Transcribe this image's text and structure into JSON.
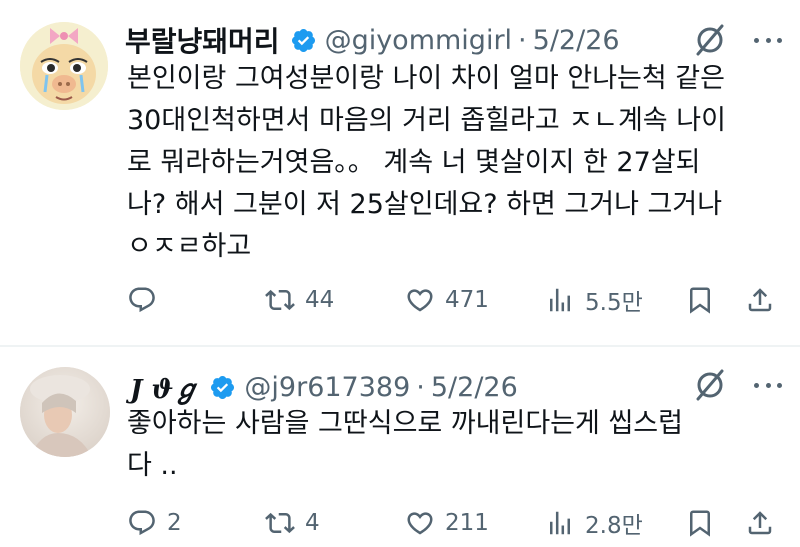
{
  "tweets": [
    {
      "display_name": "부랄냥돼머리",
      "handle": "@giyommigirl",
      "separator": "·",
      "date": "5/2/26",
      "body_lines": [
        "본인이랑 그여성분이랑 나이 차이 얼마 안나는척 같은",
        "30대인척하면서 마음의 거리 좁힐라고 ㅈㄴ계속 나이",
        "로 뭐라하는거엿음。。 계속 너 몇살이지 한 27살되",
        "나? 해서 그분이 저 25살인데요? 하면 그거나 그거나",
        "ㅇㅈㄹ하고"
      ],
      "reply_count": "",
      "retweet_count": "44",
      "like_count": "471",
      "view_count": "5.5만"
    },
    {
      "display_name": "J ϑℊ",
      "handle": "@j9r617389",
      "separator": "·",
      "date": "5/2/26",
      "body_lines": [
        "좋아하는 사람을 그딴식으로 까내린다는게 씹스럽",
        "다 .."
      ],
      "reply_count": "2",
      "retweet_count": "4",
      "like_count": "211",
      "view_count": "2.8만"
    }
  ],
  "colors": {
    "verified": "#1d9bf0",
    "secondary_text": "#536471",
    "primary_text": "#0f1419",
    "divider": "#eff3f4"
  },
  "icons": [
    "verified-badge-icon",
    "grok-icon",
    "more-icon",
    "reply-icon",
    "retweet-icon",
    "like-icon",
    "views-icon",
    "bookmark-icon",
    "share-icon"
  ]
}
